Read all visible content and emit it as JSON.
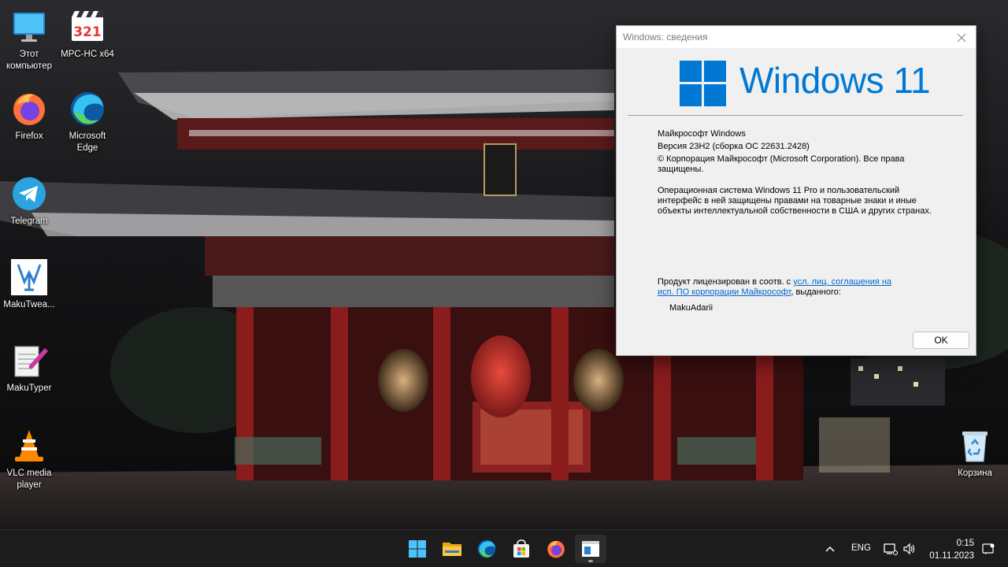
{
  "desktop": {
    "icons": [
      {
        "label": "Этот\nкомпьютер",
        "icon": "monitor-icon"
      },
      {
        "label": "MPC-HC x64",
        "icon": "mpc-hc-icon"
      },
      {
        "label": "Firefox",
        "icon": "firefox-icon"
      },
      {
        "label": "Microsoft\nEdge",
        "icon": "edge-icon"
      },
      {
        "label": "Telegram",
        "icon": "telegram-icon"
      },
      {
        "label": "MakuTwea...",
        "icon": "makutweaker-icon"
      },
      {
        "label": "MakuTyper",
        "icon": "makutyper-icon"
      },
      {
        "label": "VLC media\nplayer",
        "icon": "vlc-icon"
      },
      {
        "label": "Корзина",
        "icon": "recycle-bin-icon"
      }
    ]
  },
  "winver": {
    "title": "Windows: сведения",
    "wordmark": "Windows 11",
    "company": "Майкрософт Windows",
    "version": "Версия 23H2 (сборка ОС 22631.2428)",
    "copyright": "© Корпорация Майкрософт (Microsoft Corporation). Все права\nзащищены.",
    "description": "Операционная система Windows 11 Pro и пользовательский\nинтерфейс в ней защищены правами на товарные знаки и иные\nобъекты интеллектуальной собственности в США и других странах.",
    "license_prefix": "Продукт лицензирован в соотв. с ",
    "license_link": "усл. лиц. соглашения на\nисп. ПО корпорации Майкрософт",
    "license_suffix": ", выданного:",
    "licensee": "MakuAdarii",
    "ok_label": "OK",
    "accent": "#0078d4"
  },
  "taskbar": {
    "apps": [
      "start-icon",
      "file-explorer-icon",
      "edge-icon",
      "microsoft-store-icon",
      "firefox-icon",
      "winver-icon"
    ],
    "language": "ENG",
    "time": "0:15",
    "date": "01.11.2023"
  }
}
